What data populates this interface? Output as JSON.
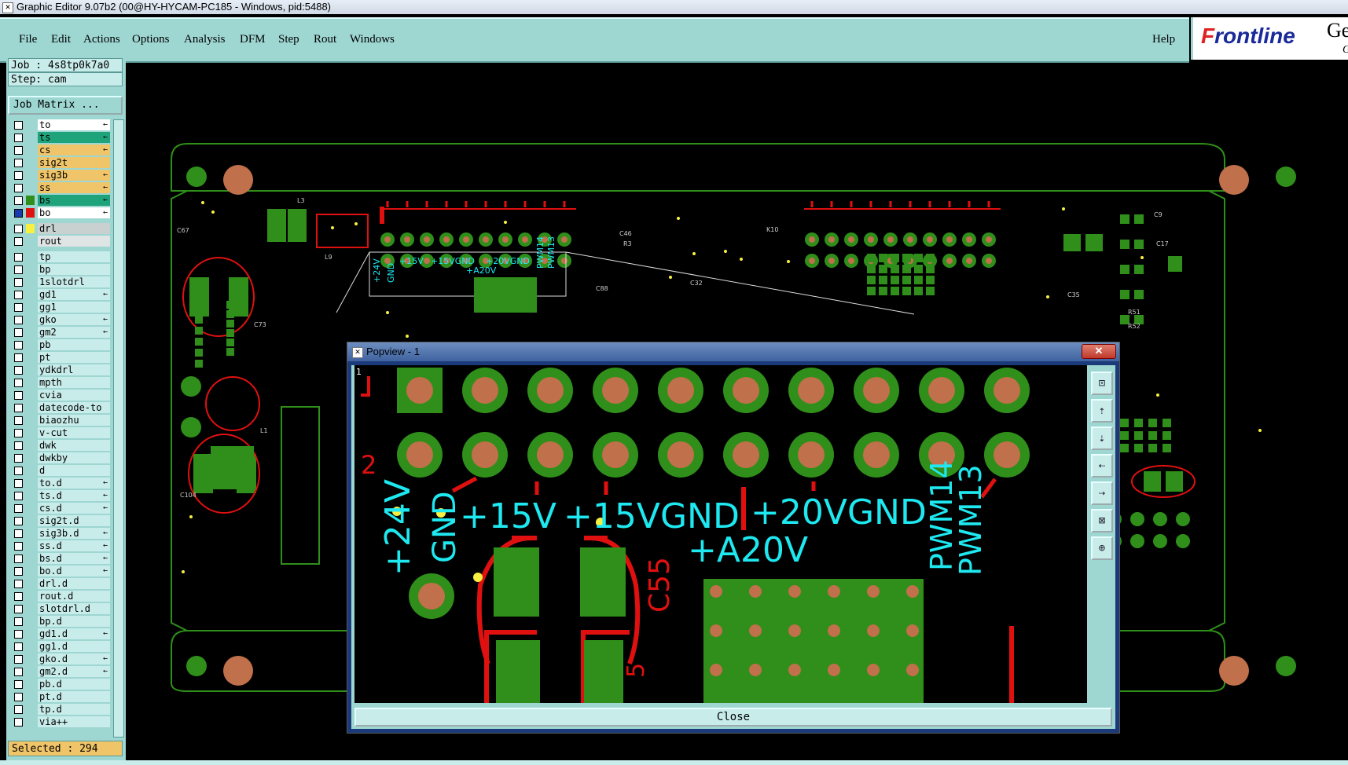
{
  "window": {
    "title": "Graphic Editor 9.07b2 (00@HY-HYCAM-PC185 - Windows, pid:5488)"
  },
  "menu": {
    "items": [
      {
        "label": "File",
        "key": "F"
      },
      {
        "label": "Edit",
        "key": "E"
      },
      {
        "label": "Actions",
        "key": "A"
      },
      {
        "label": "Options",
        "key": "O"
      },
      {
        "label": "Analysis",
        "key": "A"
      },
      {
        "label": "DFM",
        "key": "D"
      },
      {
        "label": "Step",
        "key": "S"
      },
      {
        "label": "Rout",
        "key": "R"
      },
      {
        "label": "Windows",
        "key": "W"
      }
    ],
    "help": "Help"
  },
  "logo": {
    "brand_f": "F",
    "brand_rest": "rontline",
    "ge": "Ge",
    "sub": "G"
  },
  "job": {
    "job_line": "Job : 4s8tp0k7a0",
    "step_line": "Step: cam",
    "matrix_button": "Job Matrix ..."
  },
  "layers": [
    {
      "name": "to",
      "color": "#ffffff",
      "arrow": "←"
    },
    {
      "name": "ts",
      "color": "#1fa37a",
      "arrow": "←"
    },
    {
      "name": "cs",
      "color": "#f0c56a",
      "arrow": "←"
    },
    {
      "name": "sig2t",
      "color": "#f0c56a",
      "arrow": ""
    },
    {
      "name": "sig3b",
      "color": "#f0c56a",
      "arrow": "←"
    },
    {
      "name": "ss",
      "color": "#f0c56a",
      "arrow": "←"
    },
    {
      "name": "bs",
      "color": "#1fa37a",
      "arrow": "←"
    },
    {
      "name": "bo",
      "color": "#ffffff",
      "arrow": "←"
    },
    {
      "name": "drl",
      "color": "#c8d0d0",
      "arrow": ""
    },
    {
      "name": "rout",
      "color": "#dfe4e4",
      "arrow": ""
    },
    {
      "name": "tp",
      "color": "#c8ecea",
      "arrow": ""
    },
    {
      "name": "bp",
      "color": "#c8ecea",
      "arrow": ""
    },
    {
      "name": "1slotdrl",
      "color": "#c8ecea",
      "arrow": ""
    },
    {
      "name": "gd1",
      "color": "#c8ecea",
      "arrow": "←"
    },
    {
      "name": "gg1",
      "color": "#c8ecea",
      "arrow": ""
    },
    {
      "name": "gko",
      "color": "#c8ecea",
      "arrow": "←"
    },
    {
      "name": "gm2",
      "color": "#c8ecea",
      "arrow": "←"
    },
    {
      "name": "pb",
      "color": "#c8ecea",
      "arrow": ""
    },
    {
      "name": "pt",
      "color": "#c8ecea",
      "arrow": ""
    },
    {
      "name": "ydkdrl",
      "color": "#c8ecea",
      "arrow": ""
    },
    {
      "name": "mpth",
      "color": "#c8ecea",
      "arrow": ""
    },
    {
      "name": "cvia",
      "color": "#c8ecea",
      "arrow": ""
    },
    {
      "name": "datecode-to",
      "color": "#c8ecea",
      "arrow": ""
    },
    {
      "name": "biaozhu",
      "color": "#c8ecea",
      "arrow": ""
    },
    {
      "name": "v-cut",
      "color": "#c8ecea",
      "arrow": ""
    },
    {
      "name": "dwk",
      "color": "#c8ecea",
      "arrow": ""
    },
    {
      "name": "dwkby",
      "color": "#c8ecea",
      "arrow": ""
    },
    {
      "name": "d",
      "color": "#c8ecea",
      "arrow": ""
    },
    {
      "name": "to.d",
      "color": "#c8ecea",
      "arrow": "←"
    },
    {
      "name": "ts.d",
      "color": "#c8ecea",
      "arrow": "←"
    },
    {
      "name": "cs.d",
      "color": "#c8ecea",
      "arrow": "←"
    },
    {
      "name": "sig2t.d",
      "color": "#c8ecea",
      "arrow": ""
    },
    {
      "name": "sig3b.d",
      "color": "#c8ecea",
      "arrow": "←"
    },
    {
      "name": "ss.d",
      "color": "#c8ecea",
      "arrow": "←"
    },
    {
      "name": "bs.d",
      "color": "#c8ecea",
      "arrow": "←"
    },
    {
      "name": "bo.d",
      "color": "#c8ecea",
      "arrow": "←"
    },
    {
      "name": "drl.d",
      "color": "#c8ecea",
      "arrow": ""
    },
    {
      "name": "rout.d",
      "color": "#c8ecea",
      "arrow": ""
    },
    {
      "name": "slotdrl.d",
      "color": "#c8ecea",
      "arrow": ""
    },
    {
      "name": "bp.d",
      "color": "#c8ecea",
      "arrow": ""
    },
    {
      "name": "gd1.d",
      "color": "#c8ecea",
      "arrow": "←"
    },
    {
      "name": "gg1.d",
      "color": "#c8ecea",
      "arrow": ""
    },
    {
      "name": "gko.d",
      "color": "#c8ecea",
      "arrow": "←"
    },
    {
      "name": "gm2.d",
      "color": "#c8ecea",
      "arrow": "←"
    },
    {
      "name": "pb.d",
      "color": "#c8ecea",
      "arrow": ""
    },
    {
      "name": "pt.d",
      "color": "#c8ecea",
      "arrow": ""
    },
    {
      "name": "tp.d",
      "color": "#c8ecea",
      "arrow": ""
    },
    {
      "name": "via++",
      "color": "#c8ecea",
      "arrow": ""
    }
  ],
  "selected": "Selected : 294",
  "board": {
    "silk_labels": [
      "+24V",
      "GND",
      "+15V",
      "+15VGND",
      "+20VGND",
      "+A20V",
      "PWM14",
      "PWM13",
      "C67",
      "L3",
      "C73",
      "C46",
      "L9",
      "C88",
      "R3",
      "C32",
      "K10",
      "C9",
      "C17",
      "C35",
      "C104",
      "L1",
      "R51",
      "R52"
    ]
  },
  "popview": {
    "title": "Popview - 1",
    "close_x": "✕",
    "close_button": "Close",
    "labels": {
      "v24": "+24V",
      "gnd": "GND",
      "v15": "+15V",
      "v15gnd": "+15VGND",
      "v20gnd": "+20VGND",
      "a20v": "+A20V",
      "pwm14": "PWM14",
      "pwm13": "PWM13",
      "c55": "C55",
      "mark2": "2",
      "mark5": "5",
      "mark1": "1"
    },
    "tools": [
      "zoom-fit-icon",
      "pan-up-icon",
      "pan-down-icon",
      "pan-left-icon",
      "pan-right-icon",
      "zoom-out-icon",
      "zoom-in-icon"
    ]
  },
  "colors": {
    "pad": "#2f8f1a",
    "drill": "#c0704a",
    "trace": "#e01010",
    "silk": "#1ee8f0",
    "outline": "#2f8f1a",
    "panel": "#9ed6d2"
  }
}
